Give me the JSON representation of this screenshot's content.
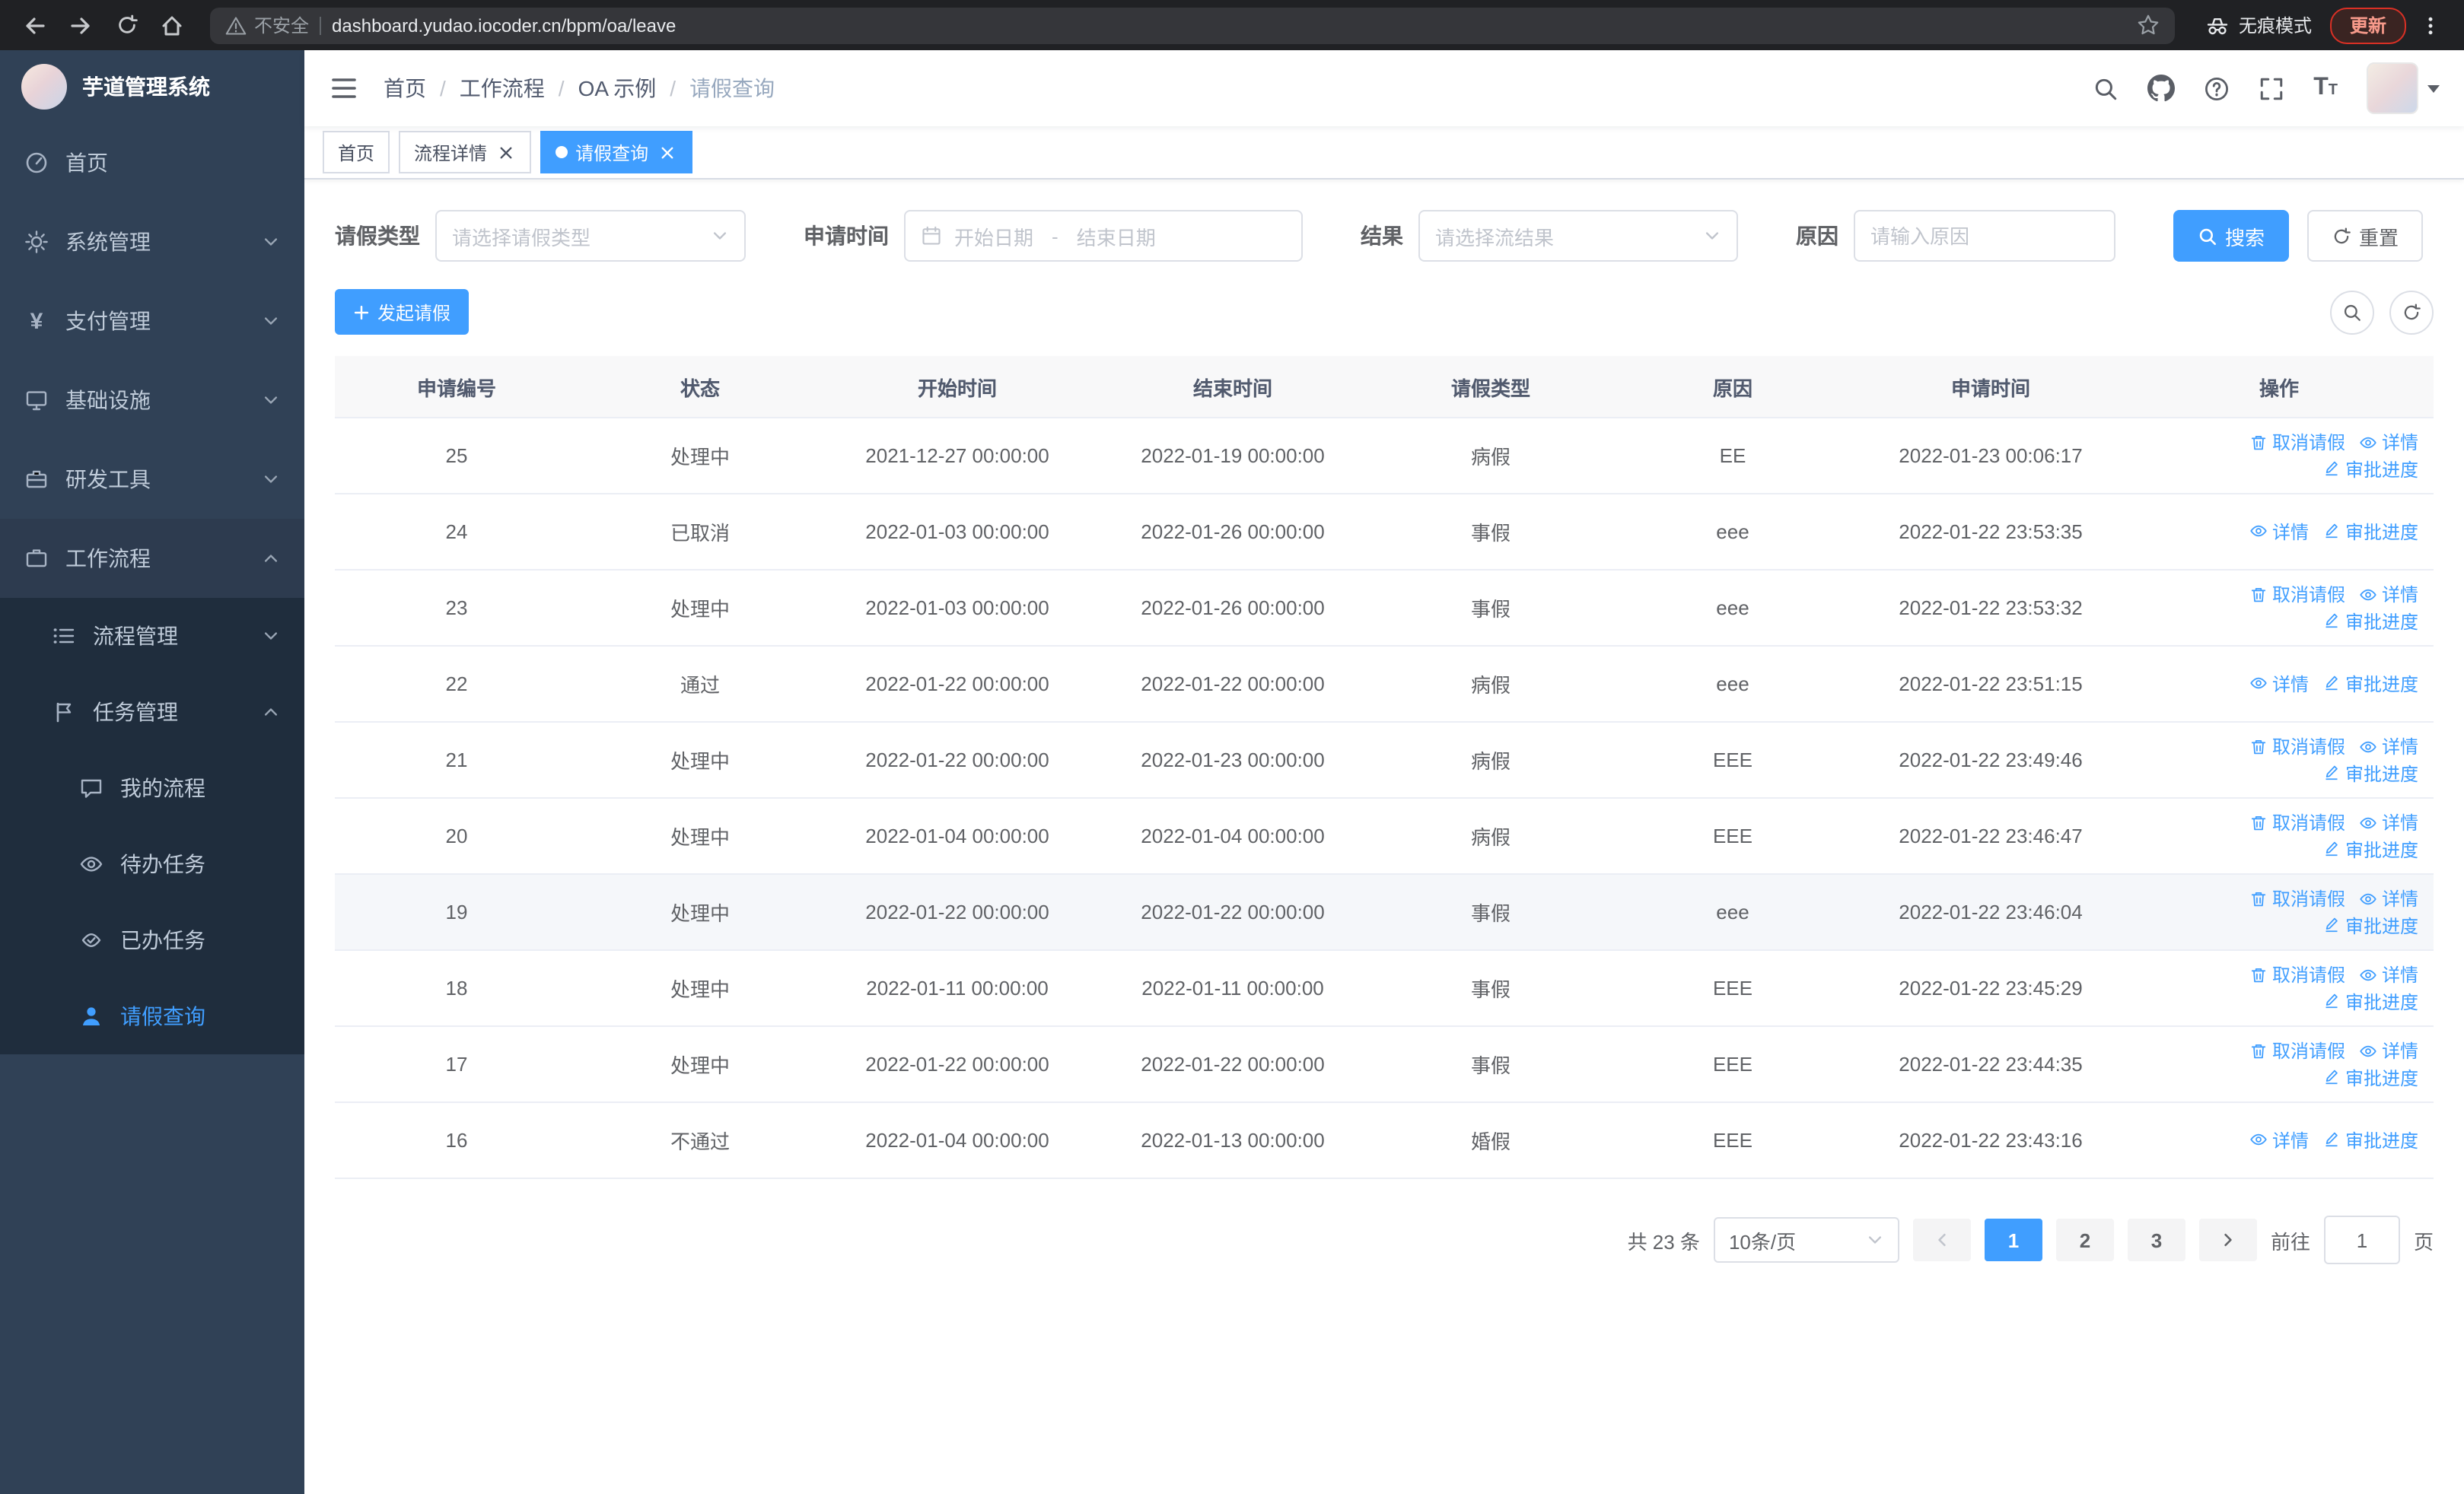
{
  "browser": {
    "security_label": "不安全",
    "url": "dashboard.yudao.iocoder.cn/bpm/oa/leave",
    "incognito_label": "无痕模式",
    "update_label": "更新"
  },
  "sidebar": {
    "title": "芋道管理系统",
    "menu": [
      {
        "label": "首页"
      },
      {
        "label": "系统管理"
      },
      {
        "label": "支付管理"
      },
      {
        "label": "基础设施"
      },
      {
        "label": "研发工具"
      },
      {
        "label": "工作流程"
      }
    ],
    "workflow_children": [
      {
        "label": "流程管理"
      },
      {
        "label": "任务管理"
      }
    ],
    "task_children": [
      {
        "label": "我的流程"
      },
      {
        "label": "待办任务"
      },
      {
        "label": "已办任务"
      },
      {
        "label": "请假查询"
      }
    ]
  },
  "header": {
    "breadcrumbs": [
      "首页",
      "工作流程",
      "OA 示例",
      "请假查询"
    ],
    "separator": "/"
  },
  "tabs": [
    {
      "label": "首页"
    },
    {
      "label": "流程详情"
    },
    {
      "label": "请假查询"
    }
  ],
  "filters": {
    "leave_type_label": "请假类型",
    "leave_type_placeholder": "请选择请假类型",
    "apply_time_label": "申请时间",
    "start_date_placeholder": "开始日期",
    "range_separator": "-",
    "end_date_placeholder": "结束日期",
    "result_label": "结果",
    "result_placeholder": "请选择流结果",
    "reason_label": "原因",
    "reason_placeholder": "请输入原因",
    "search_button": "搜索",
    "reset_button": "重置"
  },
  "toolbar": {
    "create_button": "发起请假"
  },
  "table": {
    "columns": [
      "申请编号",
      "状态",
      "开始时间",
      "结束时间",
      "请假类型",
      "原因",
      "申请时间",
      "操作"
    ],
    "actions": {
      "cancel": "取消请假",
      "detail": "详情",
      "progress": "审批进度"
    },
    "rows": [
      {
        "id": "25",
        "status": "处理中",
        "start": "2021-12-27 00:00:00",
        "end": "2022-01-19 00:00:00",
        "type": "病假",
        "reason": "EE",
        "applied": "2022-01-23 00:06:17",
        "cancellable": true,
        "highlighted": false
      },
      {
        "id": "24",
        "status": "已取消",
        "start": "2022-01-03 00:00:00",
        "end": "2022-01-26 00:00:00",
        "type": "事假",
        "reason": "eee",
        "applied": "2022-01-22 23:53:35",
        "cancellable": false,
        "highlighted": false
      },
      {
        "id": "23",
        "status": "处理中",
        "start": "2022-01-03 00:00:00",
        "end": "2022-01-26 00:00:00",
        "type": "事假",
        "reason": "eee",
        "applied": "2022-01-22 23:53:32",
        "cancellable": true,
        "highlighted": false
      },
      {
        "id": "22",
        "status": "通过",
        "start": "2022-01-22 00:00:00",
        "end": "2022-01-22 00:00:00",
        "type": "病假",
        "reason": "eee",
        "applied": "2022-01-22 23:51:15",
        "cancellable": false,
        "highlighted": false
      },
      {
        "id": "21",
        "status": "处理中",
        "start": "2022-01-22 00:00:00",
        "end": "2022-01-23 00:00:00",
        "type": "病假",
        "reason": "EEE",
        "applied": "2022-01-22 23:49:46",
        "cancellable": true,
        "highlighted": false
      },
      {
        "id": "20",
        "status": "处理中",
        "start": "2022-01-04 00:00:00",
        "end": "2022-01-04 00:00:00",
        "type": "病假",
        "reason": "EEE",
        "applied": "2022-01-22 23:46:47",
        "cancellable": true,
        "highlighted": false
      },
      {
        "id": "19",
        "status": "处理中",
        "start": "2022-01-22 00:00:00",
        "end": "2022-01-22 00:00:00",
        "type": "事假",
        "reason": "eee",
        "applied": "2022-01-22 23:46:04",
        "cancellable": true,
        "highlighted": true
      },
      {
        "id": "18",
        "status": "处理中",
        "start": "2022-01-11 00:00:00",
        "end": "2022-01-11 00:00:00",
        "type": "事假",
        "reason": "EEE",
        "applied": "2022-01-22 23:45:29",
        "cancellable": true,
        "highlighted": false
      },
      {
        "id": "17",
        "status": "处理中",
        "start": "2022-01-22 00:00:00",
        "end": "2022-01-22 00:00:00",
        "type": "事假",
        "reason": "EEE",
        "applied": "2022-01-22 23:44:35",
        "cancellable": true,
        "highlighted": false
      },
      {
        "id": "16",
        "status": "不通过",
        "start": "2022-01-04 00:00:00",
        "end": "2022-01-13 00:00:00",
        "type": "婚假",
        "reason": "EEE",
        "applied": "2022-01-22 23:43:16",
        "cancellable": false,
        "highlighted": false
      }
    ]
  },
  "pagination": {
    "total_text": "共 23 条",
    "page_size": "10条/页",
    "pages": [
      "1",
      "2",
      "3"
    ],
    "active_page": "1",
    "goto_label": "前往",
    "goto_value": "1",
    "page_unit": "页"
  },
  "icons": {
    "back-icon": "←",
    "forward-icon": "→",
    "reload-icon": "⟳",
    "home-icon": "⌂",
    "warning-icon": "⚠",
    "star-icon": "☆",
    "incognito-icon": "hat-and-glasses",
    "more-vertical-icon": "⋮",
    "collapse-sidebar-icon": "☰",
    "search-icon": "magnifier",
    "github-icon": "octocat",
    "question-icon": "?",
    "fullscreen-icon": "corners",
    "font-size-icon": "T",
    "caret-down-icon": "▾",
    "chevron-down-icon": "▾",
    "chevron-up-icon": "▴",
    "calendar-icon": "calendar",
    "plus-icon": "+",
    "refresh-icon": "⟳",
    "delete-icon": "trash",
    "view-icon": "eye",
    "edit-icon": "pencil",
    "prev-icon": "‹",
    "next-icon": "›"
  },
  "colors": {
    "primary": "#409eff",
    "sidebar_bg": "#304156",
    "submenu_bg": "#1f2d3d",
    "chrome_bg": "#202124",
    "highlight_row_bg": "#f5f7fa",
    "table_header_bg": "#f8f8f9"
  }
}
